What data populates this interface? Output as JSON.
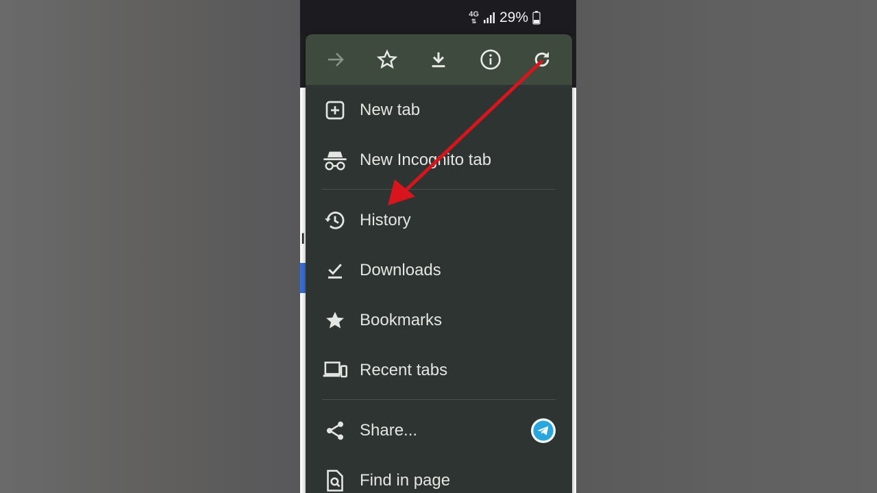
{
  "status_bar": {
    "network_type": "4G",
    "battery_percent": "29%"
  },
  "toolbar": {
    "items": [
      {
        "name": "forward-arrow-icon"
      },
      {
        "name": "star-outline-icon"
      },
      {
        "name": "download-icon"
      },
      {
        "name": "info-icon"
      },
      {
        "name": "refresh-icon"
      }
    ]
  },
  "menu": {
    "items": [
      {
        "label": "New tab",
        "icon": "plus-box-icon"
      },
      {
        "label": "New Incognito tab",
        "icon": "incognito-icon"
      },
      {
        "label": "History",
        "icon": "history-icon"
      },
      {
        "label": "Downloads",
        "icon": "downloads-check-icon"
      },
      {
        "label": "Bookmarks",
        "icon": "star-filled-icon"
      },
      {
        "label": "Recent tabs",
        "icon": "devices-icon"
      },
      {
        "label": "Share...",
        "icon": "share-icon"
      },
      {
        "label": "Find in page",
        "icon": "find-page-icon"
      }
    ]
  },
  "colors": {
    "menu_bg": "#2e3431",
    "toolbar_bg": "#3e4a3e",
    "annotation_arrow": "#d8141c",
    "telegram": "#2aa6df"
  }
}
